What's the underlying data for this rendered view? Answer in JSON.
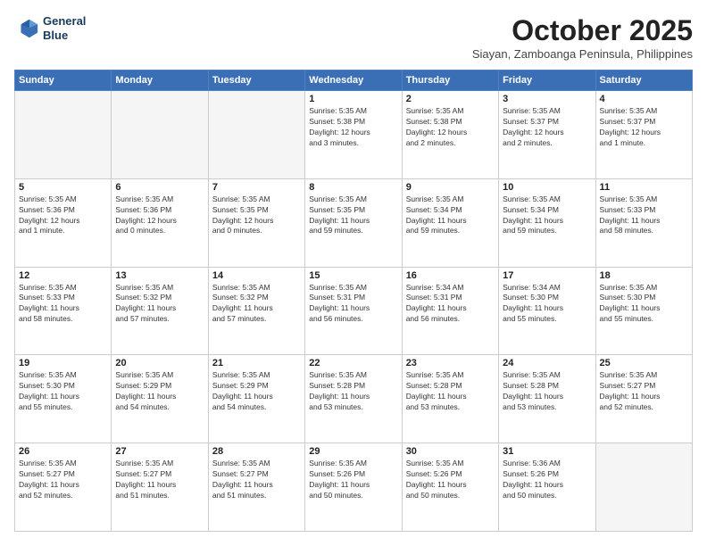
{
  "header": {
    "logo_line1": "General",
    "logo_line2": "Blue",
    "month": "October 2025",
    "location": "Siayan, Zamboanga Peninsula, Philippines"
  },
  "weekdays": [
    "Sunday",
    "Monday",
    "Tuesday",
    "Wednesday",
    "Thursday",
    "Friday",
    "Saturday"
  ],
  "weeks": [
    [
      {
        "day": "",
        "info": ""
      },
      {
        "day": "",
        "info": ""
      },
      {
        "day": "",
        "info": ""
      },
      {
        "day": "1",
        "info": "Sunrise: 5:35 AM\nSunset: 5:38 PM\nDaylight: 12 hours\nand 3 minutes."
      },
      {
        "day": "2",
        "info": "Sunrise: 5:35 AM\nSunset: 5:38 PM\nDaylight: 12 hours\nand 2 minutes."
      },
      {
        "day": "3",
        "info": "Sunrise: 5:35 AM\nSunset: 5:37 PM\nDaylight: 12 hours\nand 2 minutes."
      },
      {
        "day": "4",
        "info": "Sunrise: 5:35 AM\nSunset: 5:37 PM\nDaylight: 12 hours\nand 1 minute."
      }
    ],
    [
      {
        "day": "5",
        "info": "Sunrise: 5:35 AM\nSunset: 5:36 PM\nDaylight: 12 hours\nand 1 minute."
      },
      {
        "day": "6",
        "info": "Sunrise: 5:35 AM\nSunset: 5:36 PM\nDaylight: 12 hours\nand 0 minutes."
      },
      {
        "day": "7",
        "info": "Sunrise: 5:35 AM\nSunset: 5:35 PM\nDaylight: 12 hours\nand 0 minutes."
      },
      {
        "day": "8",
        "info": "Sunrise: 5:35 AM\nSunset: 5:35 PM\nDaylight: 11 hours\nand 59 minutes."
      },
      {
        "day": "9",
        "info": "Sunrise: 5:35 AM\nSunset: 5:34 PM\nDaylight: 11 hours\nand 59 minutes."
      },
      {
        "day": "10",
        "info": "Sunrise: 5:35 AM\nSunset: 5:34 PM\nDaylight: 11 hours\nand 59 minutes."
      },
      {
        "day": "11",
        "info": "Sunrise: 5:35 AM\nSunset: 5:33 PM\nDaylight: 11 hours\nand 58 minutes."
      }
    ],
    [
      {
        "day": "12",
        "info": "Sunrise: 5:35 AM\nSunset: 5:33 PM\nDaylight: 11 hours\nand 58 minutes."
      },
      {
        "day": "13",
        "info": "Sunrise: 5:35 AM\nSunset: 5:32 PM\nDaylight: 11 hours\nand 57 minutes."
      },
      {
        "day": "14",
        "info": "Sunrise: 5:35 AM\nSunset: 5:32 PM\nDaylight: 11 hours\nand 57 minutes."
      },
      {
        "day": "15",
        "info": "Sunrise: 5:35 AM\nSunset: 5:31 PM\nDaylight: 11 hours\nand 56 minutes."
      },
      {
        "day": "16",
        "info": "Sunrise: 5:34 AM\nSunset: 5:31 PM\nDaylight: 11 hours\nand 56 minutes."
      },
      {
        "day": "17",
        "info": "Sunrise: 5:34 AM\nSunset: 5:30 PM\nDaylight: 11 hours\nand 55 minutes."
      },
      {
        "day": "18",
        "info": "Sunrise: 5:35 AM\nSunset: 5:30 PM\nDaylight: 11 hours\nand 55 minutes."
      }
    ],
    [
      {
        "day": "19",
        "info": "Sunrise: 5:35 AM\nSunset: 5:30 PM\nDaylight: 11 hours\nand 55 minutes."
      },
      {
        "day": "20",
        "info": "Sunrise: 5:35 AM\nSunset: 5:29 PM\nDaylight: 11 hours\nand 54 minutes."
      },
      {
        "day": "21",
        "info": "Sunrise: 5:35 AM\nSunset: 5:29 PM\nDaylight: 11 hours\nand 54 minutes."
      },
      {
        "day": "22",
        "info": "Sunrise: 5:35 AM\nSunset: 5:28 PM\nDaylight: 11 hours\nand 53 minutes."
      },
      {
        "day": "23",
        "info": "Sunrise: 5:35 AM\nSunset: 5:28 PM\nDaylight: 11 hours\nand 53 minutes."
      },
      {
        "day": "24",
        "info": "Sunrise: 5:35 AM\nSunset: 5:28 PM\nDaylight: 11 hours\nand 53 minutes."
      },
      {
        "day": "25",
        "info": "Sunrise: 5:35 AM\nSunset: 5:27 PM\nDaylight: 11 hours\nand 52 minutes."
      }
    ],
    [
      {
        "day": "26",
        "info": "Sunrise: 5:35 AM\nSunset: 5:27 PM\nDaylight: 11 hours\nand 52 minutes."
      },
      {
        "day": "27",
        "info": "Sunrise: 5:35 AM\nSunset: 5:27 PM\nDaylight: 11 hours\nand 51 minutes."
      },
      {
        "day": "28",
        "info": "Sunrise: 5:35 AM\nSunset: 5:27 PM\nDaylight: 11 hours\nand 51 minutes."
      },
      {
        "day": "29",
        "info": "Sunrise: 5:35 AM\nSunset: 5:26 PM\nDaylight: 11 hours\nand 50 minutes."
      },
      {
        "day": "30",
        "info": "Sunrise: 5:35 AM\nSunset: 5:26 PM\nDaylight: 11 hours\nand 50 minutes."
      },
      {
        "day": "31",
        "info": "Sunrise: 5:36 AM\nSunset: 5:26 PM\nDaylight: 11 hours\nand 50 minutes."
      },
      {
        "day": "",
        "info": ""
      }
    ]
  ]
}
